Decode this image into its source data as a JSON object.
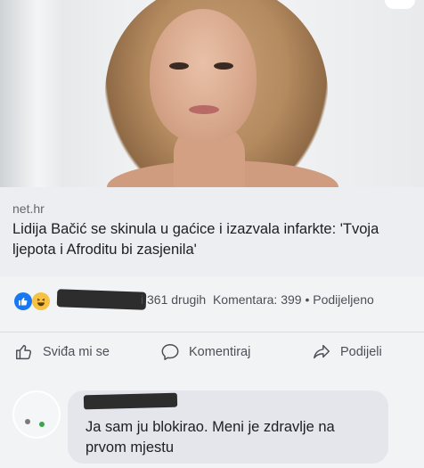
{
  "link_preview": {
    "domain": "net.hr",
    "headline": "Lidija Bačić se skinula u gaćice i izazvala infarkte: 'Tvoja ljepota i Afroditu bi zasjenila'"
  },
  "reactions": {
    "summary": "i 361 drugih",
    "comments": "Komentara: 399",
    "separator": "•",
    "shares": "Podijeljeno"
  },
  "actions": {
    "like_label": "Sviđa mi se",
    "comment_label": "Komentiraj",
    "share_label": "Podijeli"
  },
  "comment": {
    "text": "Ja sam ju blokirao. Meni je zdravlje na prvom mjestu"
  },
  "colors": {
    "facebook_blue": "#1877f2",
    "haha_yellow": "#f7c244",
    "bubble_gray": "#e4e6eb"
  },
  "icons": [
    "like-icon",
    "haha-icon",
    "thumbs-up-icon",
    "comment-icon",
    "share-icon"
  ]
}
